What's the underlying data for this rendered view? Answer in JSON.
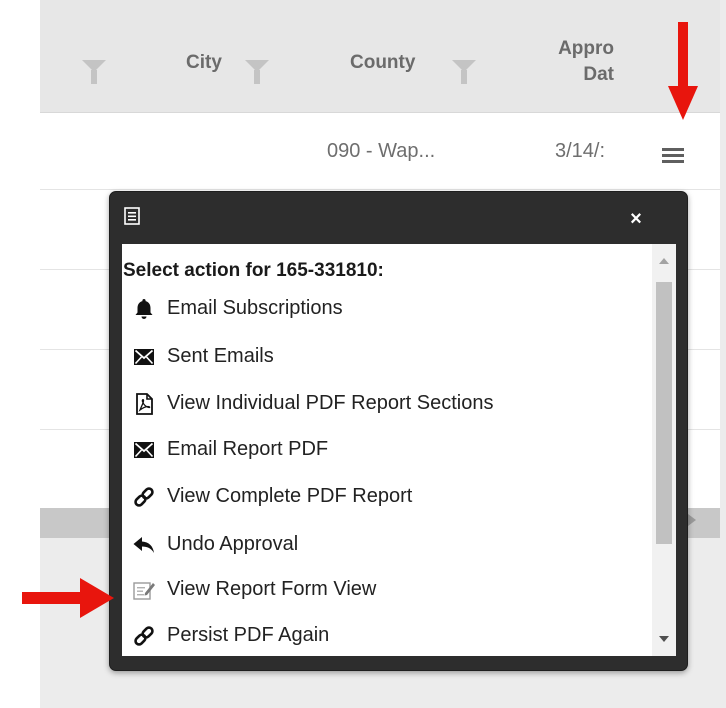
{
  "grid": {
    "columns": [
      {
        "label": ""
      },
      {
        "label": "City"
      },
      {
        "label": "County"
      },
      {
        "label": "Appro Dat"
      }
    ],
    "row": {
      "county": "090 - Wap...",
      "approval_date": "3/14/:"
    },
    "menu_icon": "hamburger-menu-icon"
  },
  "popup": {
    "title_icon": "document-list-icon",
    "close_label": "×",
    "heading": "Select action for 165-331810:",
    "actions": [
      {
        "label": "Email Subscriptions",
        "icon": "bell-icon"
      },
      {
        "label": "Sent Emails",
        "icon": "envelope-icon"
      },
      {
        "label": "View Individual PDF Report Sections",
        "icon": "pdf-icon"
      },
      {
        "label": "Email Report PDF",
        "icon": "envelope-icon"
      },
      {
        "label": "View Complete PDF Report",
        "icon": "link-icon"
      },
      {
        "label": "Undo Approval",
        "icon": "reply-icon"
      },
      {
        "label": "View Report Form View",
        "icon": "edit-form-icon"
      },
      {
        "label": "Persist PDF Again",
        "icon": "link-icon"
      }
    ]
  },
  "annotations": {
    "arrow_color": "#e8150d"
  }
}
